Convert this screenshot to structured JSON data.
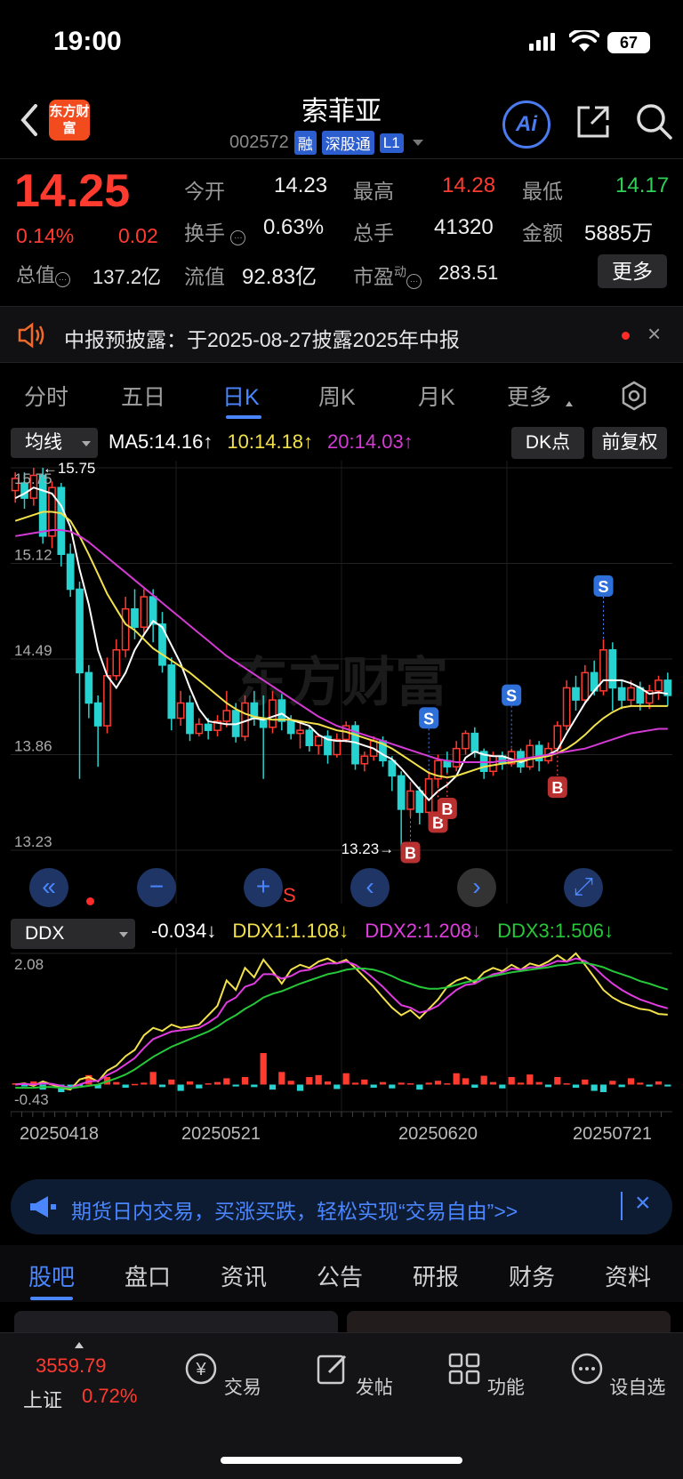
{
  "status_bar": {
    "time": "19:00",
    "battery": "67"
  },
  "header": {
    "title": "索菲亚",
    "code": "002572",
    "tags": [
      "融",
      "深股通",
      "L1"
    ],
    "logo_text": "东方财富",
    "ai_label": "Ai"
  },
  "quote": {
    "price": "14.25",
    "change_pct": "0.14%",
    "change_abs": "0.02",
    "open_label": "今开",
    "open": "14.23",
    "high_label": "最高",
    "high": "14.28",
    "low_label": "最低",
    "low": "14.17",
    "turnover_label": "换手",
    "turnover": "0.63%",
    "volume_label": "总手",
    "volume": "41320",
    "amount_label": "金额",
    "amount": "5885万",
    "mktcap_label": "总值",
    "mktcap": "137.2亿",
    "float_label": "流值",
    "float": "92.83亿",
    "pe_label": "市盈",
    "pe_sup": "动",
    "pe": "283.51",
    "more": "更多"
  },
  "notice": {
    "text": "中报预披露：于2025-08-27披露2025年中报"
  },
  "tabs": [
    {
      "label": "分时"
    },
    {
      "label": "五日"
    },
    {
      "label": "日K"
    },
    {
      "label": "周K"
    },
    {
      "label": "月K"
    },
    {
      "label": "更多"
    }
  ],
  "ma_bar": {
    "dropdown": "均线",
    "ma5": "MA5:14.16↑",
    "ma10": "10:14.18↑",
    "ma20": "20:14.03↑",
    "dk": "DK点",
    "fq": "前复权"
  },
  "colors": {
    "up": "#ff3b30",
    "down": "#27d3d0",
    "ma5": "#ffffff",
    "ma10": "#f2e14b",
    "ma20": "#d43ad4",
    "ddx": "#ffffff",
    "ddx1": "#f2e14b",
    "ddx2": "#e03ce0",
    "ddx3": "#26c83a",
    "accent": "#4a86ff"
  },
  "watermark": "东方财富",
  "chart_data": [
    {
      "type": "candlestick",
      "price_labels": [
        "15.75",
        "15.12",
        "14.49",
        "13.86",
        "13.23"
      ],
      "ylim": [
        13.23,
        15.75
      ],
      "high_mark": "15.75",
      "low_mark": "13.23",
      "ohlc": [
        [
          15.6,
          15.68,
          15.52,
          15.72
        ],
        [
          15.65,
          15.55,
          15.48,
          15.72
        ],
        [
          15.55,
          15.7,
          15.5,
          15.75
        ],
        [
          15.7,
          15.3,
          15.25,
          15.75
        ],
        [
          15.3,
          15.62,
          15.22,
          15.66
        ],
        [
          15.62,
          15.18,
          15.1,
          15.65
        ],
        [
          15.18,
          14.95,
          14.9,
          15.25
        ],
        [
          14.95,
          14.4,
          13.7,
          15.0
        ],
        [
          14.4,
          14.2,
          14.1,
          14.45
        ],
        [
          14.2,
          14.05,
          13.78,
          14.25
        ],
        [
          14.05,
          14.38,
          14.0,
          14.5
        ],
        [
          14.38,
          14.55,
          14.35,
          14.62
        ],
        [
          14.55,
          14.82,
          14.5,
          14.9
        ],
        [
          14.82,
          14.7,
          14.62,
          14.95
        ],
        [
          14.7,
          14.9,
          14.65,
          14.95
        ],
        [
          14.9,
          14.72,
          14.6,
          14.95
        ],
        [
          14.72,
          14.45,
          14.4,
          14.8
        ],
        [
          14.45,
          14.1,
          14.02,
          14.5
        ],
        [
          14.1,
          14.2,
          14.05,
          14.28
        ],
        [
          14.2,
          14.0,
          13.95,
          14.25
        ],
        [
          14.0,
          14.06,
          13.98,
          14.1
        ],
        [
          14.06,
          14.02,
          13.96,
          14.1
        ],
        [
          14.02,
          14.08,
          13.98,
          14.12
        ],
        [
          14.08,
          14.15,
          14.04,
          14.28
        ],
        [
          14.15,
          13.98,
          13.94,
          14.2
        ],
        [
          13.98,
          14.2,
          13.95,
          14.25
        ],
        [
          14.2,
          14.1,
          14.05,
          14.28
        ],
        [
          14.1,
          14.04,
          13.7,
          14.25
        ],
        [
          14.04,
          14.22,
          14.0,
          14.28
        ],
        [
          14.22,
          14.08,
          14.02,
          14.26
        ],
        [
          14.08,
          14.0,
          13.96,
          14.12
        ],
        [
          14.0,
          14.02,
          13.9,
          14.08
        ],
        [
          14.02,
          13.92,
          13.88,
          14.05
        ],
        [
          13.92,
          13.98,
          13.86,
          14.0
        ],
        [
          13.98,
          13.86,
          13.8,
          14.02
        ],
        [
          13.86,
          13.96,
          13.84,
          14.0
        ],
        [
          13.96,
          14.05,
          13.94,
          14.08
        ],
        [
          14.05,
          13.8,
          13.76,
          14.08
        ],
        [
          13.8,
          13.85,
          13.75,
          13.88
        ],
        [
          13.85,
          13.95,
          13.82,
          13.98
        ],
        [
          13.95,
          13.82,
          13.78,
          13.98
        ],
        [
          13.82,
          13.72,
          13.62,
          13.85
        ],
        [
          13.72,
          13.5,
          13.23,
          13.75
        ],
        [
          13.5,
          13.62,
          13.45,
          13.68
        ],
        [
          13.62,
          13.48,
          13.4,
          13.65
        ],
        [
          13.48,
          13.7,
          13.45,
          13.75
        ],
        [
          13.7,
          13.82,
          13.65,
          13.86
        ],
        [
          13.82,
          13.78,
          13.74,
          13.88
        ],
        [
          13.78,
          13.9,
          13.75,
          13.95
        ],
        [
          13.9,
          14.0,
          13.86,
          14.02
        ],
        [
          14.0,
          13.88,
          13.84,
          14.04
        ],
        [
          13.88,
          13.75,
          13.7,
          13.9
        ],
        [
          13.75,
          13.85,
          13.72,
          13.88
        ],
        [
          13.85,
          13.8,
          13.76,
          13.88
        ],
        [
          13.8,
          13.88,
          13.78,
          13.9
        ],
        [
          13.88,
          13.78,
          13.74,
          13.9
        ],
        [
          13.78,
          13.92,
          13.76,
          13.96
        ],
        [
          13.92,
          13.82,
          13.75,
          13.95
        ],
        [
          13.82,
          13.9,
          13.8,
          13.94
        ],
        [
          13.9,
          14.05,
          13.88,
          14.08
        ],
        [
          14.05,
          14.3,
          14.02,
          14.35
        ],
        [
          14.3,
          14.22,
          14.15,
          14.38
        ],
        [
          14.22,
          14.4,
          14.2,
          14.45
        ],
        [
          14.4,
          14.28,
          14.25,
          14.48
        ],
        [
          14.28,
          14.55,
          14.25,
          14.62
        ],
        [
          14.55,
          14.3,
          14.15,
          14.6
        ],
        [
          14.3,
          14.22,
          14.16,
          14.35
        ],
        [
          14.22,
          14.3,
          14.18,
          14.35
        ],
        [
          14.3,
          14.2,
          14.15,
          14.34
        ],
        [
          14.2,
          14.28,
          14.16,
          14.32
        ],
        [
          14.28,
          14.35,
          14.22,
          14.38
        ],
        [
          14.35,
          14.25,
          14.18,
          14.4
        ]
      ],
      "series": [
        {
          "name": "MA5",
          "values": [
            15.55,
            15.58,
            15.62,
            15.6,
            15.58,
            15.5,
            15.36,
            15.08,
            14.85,
            14.55,
            14.38,
            14.3,
            14.4,
            14.55,
            14.65,
            14.74,
            14.7,
            14.58,
            14.46,
            14.3,
            14.16,
            14.08,
            14.07,
            14.06,
            14.06,
            14.08,
            14.1,
            14.09,
            14.11,
            14.13,
            14.09,
            14.07,
            14.05,
            13.99,
            13.96,
            13.95,
            13.95,
            13.94,
            13.92,
            13.9,
            13.86,
            13.83,
            13.77,
            13.7,
            13.63,
            13.56,
            13.62,
            13.66,
            13.72,
            13.84,
            13.88,
            13.86,
            13.85,
            13.85,
            13.83,
            13.81,
            13.83,
            13.84,
            13.86,
            13.89,
            14.0,
            14.1,
            14.2,
            14.28,
            14.35,
            14.35,
            14.35,
            14.33,
            14.3,
            14.26,
            14.27,
            14.26
          ]
        },
        {
          "name": "10",
          "values": [
            15.4,
            15.42,
            15.44,
            15.46,
            15.46,
            15.45,
            15.4,
            15.3,
            15.18,
            15.05,
            14.92,
            14.82,
            14.72,
            14.68,
            14.62,
            14.56,
            14.52,
            14.48,
            14.44,
            14.4,
            14.35,
            14.3,
            14.25,
            14.2,
            14.16,
            14.13,
            14.11,
            14.1,
            14.09,
            14.09,
            14.09,
            14.08,
            14.07,
            14.06,
            14.04,
            14.02,
            14.01,
            13.99,
            13.97,
            13.95,
            13.93,
            13.9,
            13.86,
            13.82,
            13.78,
            13.74,
            13.72,
            13.71,
            13.72,
            13.74,
            13.76,
            13.78,
            13.79,
            13.8,
            13.81,
            13.82,
            13.83,
            13.84,
            13.85,
            13.87,
            13.9,
            13.94,
            13.99,
            14.05,
            14.1,
            14.14,
            14.17,
            14.18,
            14.18,
            14.18,
            14.18,
            14.18
          ]
        },
        {
          "name": "20",
          "values": [
            15.3,
            15.31,
            15.32,
            15.33,
            15.34,
            15.34,
            15.33,
            15.3,
            15.26,
            15.21,
            15.16,
            15.11,
            15.06,
            15.01,
            14.96,
            14.91,
            14.86,
            14.81,
            14.76,
            14.71,
            14.66,
            14.61,
            14.56,
            14.51,
            14.47,
            14.43,
            14.39,
            14.35,
            14.31,
            14.27,
            14.23,
            14.19,
            14.15,
            14.11,
            14.08,
            14.05,
            14.03,
            14.01,
            13.99,
            13.97,
            13.95,
            13.93,
            13.91,
            13.89,
            13.87,
            13.85,
            13.83,
            13.82,
            13.81,
            13.81,
            13.81,
            13.81,
            13.81,
            13.82,
            13.82,
            13.83,
            13.84,
            13.85,
            13.86,
            13.87,
            13.88,
            13.89,
            13.9,
            13.92,
            13.94,
            13.96,
            13.98,
            14.0,
            14.01,
            14.02,
            14.03,
            14.03
          ]
        }
      ],
      "markers": [
        {
          "type": "S",
          "index": 45
        },
        {
          "type": "S",
          "index": 54
        },
        {
          "type": "S",
          "index": 64
        },
        {
          "type": "B",
          "index": 43
        },
        {
          "type": "B",
          "index": 46
        },
        {
          "type": "B",
          "index": 47
        },
        {
          "type": "B",
          "index": 59
        }
      ]
    },
    {
      "type": "line",
      "indicator": "DDX",
      "labels": {
        "dropdown": "DDX",
        "ddx": "-0.034↓",
        "ddx1": "DDX1:1.108↓",
        "ddx2": "DDX2:1.208↓",
        "ddx3": "DDX3:1.506↓"
      },
      "y_labels": [
        "2.08",
        "-0.43"
      ],
      "ylim": [
        -0.43,
        2.08
      ],
      "x_labels": [
        "20250418",
        "20250521",
        "20250620",
        "20250721"
      ],
      "bars": [
        0.02,
        -0.03,
        0.05,
        -0.08,
        0.01,
        -0.12,
        -0.05,
        -0.02,
        0.15,
        -0.06,
        0.12,
        0.04,
        -0.05,
        0.01,
        0.03,
        0.2,
        -0.04,
        0.08,
        -0.1,
        0.05,
        -0.06,
        0.02,
        0.04,
        0.1,
        -0.03,
        0.12,
        -0.04,
        0.5,
        -0.08,
        0.2,
        0.06,
        -0.1,
        0.12,
        0.15,
        0.05,
        -0.07,
        0.18,
        0.03,
        0.08,
        -0.05,
        0.04,
        -0.06,
        0.03,
        0.02,
        -0.08,
        0.03,
        0.06,
        0.02,
        0.18,
        0.1,
        -0.05,
        0.14,
        0.04,
        -0.06,
        0.12,
        0.03,
        0.16,
        0.04,
        -0.04,
        0.12,
        0.02,
        -0.05,
        0.08,
        -0.1,
        -0.12,
        0.06,
        -0.04,
        0.1,
        0.03,
        -0.03,
        0.05,
        -0.03
      ],
      "series": [
        {
          "name": "DDX1",
          "values": [
            0.0,
            0.02,
            -0.02,
            0.05,
            0.0,
            -0.05,
            -0.08,
            0.08,
            0.12,
            0.05,
            0.22,
            0.3,
            0.45,
            0.55,
            0.78,
            0.9,
            0.85,
            0.95,
            0.9,
            0.92,
            0.95,
            1.1,
            1.25,
            1.65,
            1.5,
            1.85,
            1.7,
            1.98,
            1.8,
            1.6,
            1.82,
            1.9,
            1.85,
            1.95,
            2.0,
            1.92,
            1.98,
            1.85,
            1.7,
            1.55,
            1.38,
            1.22,
            1.1,
            1.18,
            1.05,
            1.2,
            1.35,
            1.55,
            1.65,
            1.7,
            1.62,
            1.78,
            1.85,
            1.8,
            1.9,
            1.82,
            1.92,
            1.88,
            1.95,
            2.05,
            1.95,
            2.08,
            1.9,
            1.7,
            1.5,
            1.38,
            1.3,
            1.25,
            1.2,
            1.18,
            1.12,
            1.108
          ]
        },
        {
          "name": "DDX2",
          "values": [
            0.0,
            0.01,
            0.0,
            0.02,
            0.01,
            -0.02,
            -0.05,
            0.0,
            0.05,
            0.06,
            0.15,
            0.22,
            0.32,
            0.42,
            0.58,
            0.72,
            0.78,
            0.84,
            0.86,
            0.88,
            0.9,
            0.98,
            1.08,
            1.3,
            1.38,
            1.55,
            1.6,
            1.75,
            1.75,
            1.68,
            1.72,
            1.8,
            1.82,
            1.88,
            1.92,
            1.92,
            1.95,
            1.9,
            1.8,
            1.68,
            1.55,
            1.4,
            1.26,
            1.22,
            1.14,
            1.18,
            1.25,
            1.38,
            1.5,
            1.58,
            1.6,
            1.68,
            1.75,
            1.78,
            1.84,
            1.82,
            1.86,
            1.86,
            1.9,
            1.96,
            1.95,
            2.0,
            1.96,
            1.86,
            1.72,
            1.6,
            1.5,
            1.42,
            1.35,
            1.3,
            1.25,
            1.208
          ]
        },
        {
          "name": "DDX3",
          "values": [
            -0.05,
            -0.05,
            -0.05,
            -0.04,
            -0.04,
            -0.05,
            -0.06,
            -0.04,
            -0.02,
            0.0,
            0.05,
            0.1,
            0.16,
            0.24,
            0.34,
            0.44,
            0.52,
            0.6,
            0.66,
            0.72,
            0.78,
            0.84,
            0.92,
            1.02,
            1.1,
            1.2,
            1.28,
            1.38,
            1.44,
            1.48,
            1.54,
            1.6,
            1.65,
            1.7,
            1.75,
            1.78,
            1.82,
            1.84,
            1.84,
            1.82,
            1.78,
            1.72,
            1.65,
            1.6,
            1.55,
            1.52,
            1.52,
            1.54,
            1.58,
            1.62,
            1.65,
            1.69,
            1.72,
            1.75,
            1.78,
            1.8,
            1.82,
            1.84,
            1.86,
            1.89,
            1.9,
            1.93,
            1.93,
            1.9,
            1.86,
            1.8,
            1.75,
            1.7,
            1.64,
            1.6,
            1.55,
            1.506
          ]
        }
      ]
    }
  ],
  "chart_controls": {
    "s_label": "S"
  },
  "ad": {
    "text": "期货日内交易，买涨买跌，轻松实现“交易自由”>>"
  },
  "sub_tabs": [
    {
      "label": "股吧"
    },
    {
      "label": "盘口"
    },
    {
      "label": "资讯"
    },
    {
      "label": "公告"
    },
    {
      "label": "研报"
    },
    {
      "label": "财务"
    },
    {
      "label": "资料"
    }
  ],
  "nav": {
    "index_value": "3559.79",
    "index_name": "上证",
    "index_change": "0.72%",
    "items": [
      {
        "label": "交易"
      },
      {
        "label": "发帖"
      },
      {
        "label": "功能"
      },
      {
        "label": "设自选"
      }
    ]
  }
}
